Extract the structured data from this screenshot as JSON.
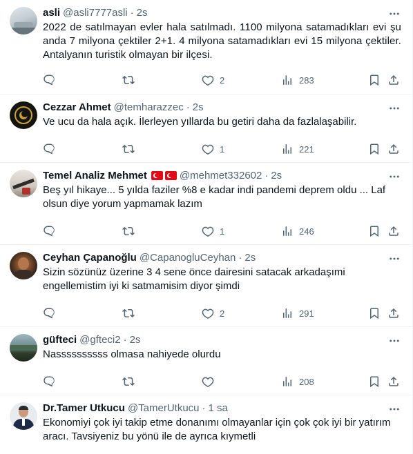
{
  "tweets": [
    {
      "name": "asli",
      "handle": "@asli7777asli",
      "time": "2s",
      "text": "2022 de satılmayan evler hala satılmadı. 1100 milyona satamadıkları evi şu anda 7 milyona çektiler 2+1. 4 milyona satamadıkları evi 15 milyona çektiler. Antalyanın turistik olmayan bir ilçesi.",
      "replies": "",
      "retweets": "",
      "likes": "2",
      "views": "283",
      "avatar_colors": [
        "#c9d4da",
        "#8a9aa3"
      ]
    },
    {
      "name": "Cezzar Ahmet",
      "handle": "@temharazzec",
      "time": "2s",
      "text": "Ve ucu da hala açık. İlerleyen yıllarda bu getiri daha da fazlalaşabilir.",
      "replies": "",
      "retweets": "",
      "likes": "1",
      "views": "221",
      "avatar_colors": [
        "#1b1a14",
        "#c8a33c"
      ]
    },
    {
      "name": "Temel Analiz Mehmet",
      "flags": "🇹🇷🇹🇷",
      "handle": "@mehmet332602",
      "time": "2s",
      "text": "Beş yıl hikaye... 5 yılda faziler %8 e kadar indi pandemi deprem oldu ... Laf olsun diye yorum yapmamak lazım",
      "replies": "",
      "retweets": "",
      "likes": "1",
      "views": "246",
      "avatar_colors": [
        "#d9d4cc",
        "#3b3a36"
      ]
    },
    {
      "name": "Ceyhan Çapanoğlu",
      "handle": "@CapanogluCeyhan",
      "time": "2s",
      "text": "Sizin sözünüz üzerine 3 4 sene önce dairesini satacak arkadaşımi engellemistim iyi ki satmamisim diyor şimdi",
      "replies": "",
      "retweets": "",
      "likes": "2",
      "views": "291",
      "avatar_colors": [
        "#2a2420",
        "#b06a3a"
      ]
    },
    {
      "name": "güfteci",
      "handle": "@gfteci2",
      "time": "2s",
      "text": "Nassssssssss olmasa nahiyede olurdu",
      "replies": "",
      "retweets": "",
      "likes": "",
      "views": "208",
      "avatar_colors": [
        "#7f9aa0",
        "#2e3b2c"
      ]
    },
    {
      "name": "Dr.Tamer Utkucu",
      "handle": "@TamerUtkucu",
      "time": "1 sa",
      "text": "Ekonomiyi çok iyi takip etme donanımı olmayanlar için çok çok iyi bir yatırım aracı. Tavsiyeniz bu yönü ile de ayrıca kıymetli",
      "replies": "",
      "retweets": "",
      "likes": "",
      "views": "",
      "avatar_colors": [
        "#e8eaec",
        "#1f2a44"
      ]
    }
  ],
  "icons": {
    "more": "more-horizontal-icon",
    "reply": "reply-icon",
    "retweet": "retweet-icon",
    "like": "heart-icon",
    "views": "views-chart-icon",
    "bookmark": "bookmark-icon",
    "share": "share-icon"
  }
}
